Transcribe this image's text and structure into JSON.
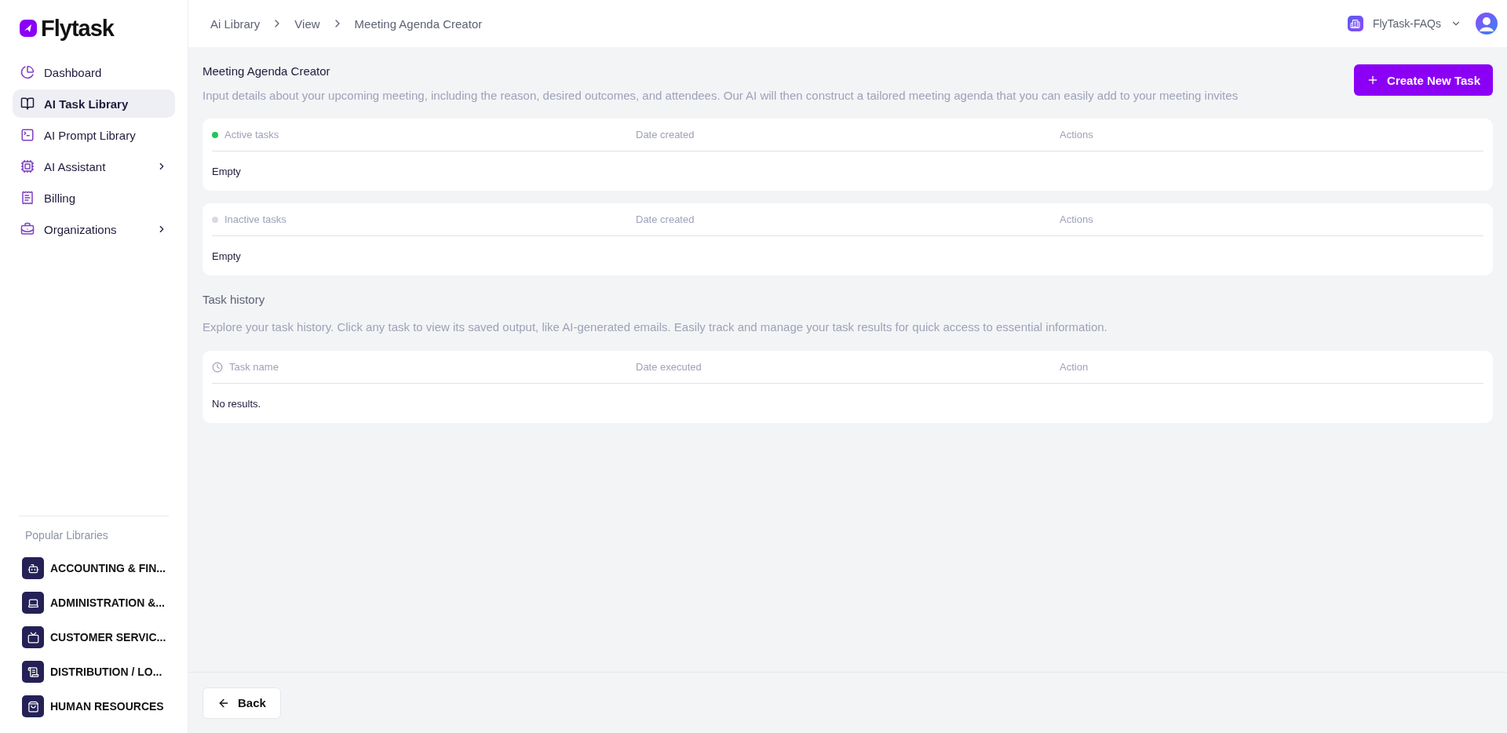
{
  "logo": "Flytask",
  "sidebar": {
    "items": [
      {
        "label": "Dashboard",
        "selected": false,
        "expandable": false
      },
      {
        "label": "AI Task Library",
        "selected": true,
        "expandable": false
      },
      {
        "label": "AI Prompt Library",
        "selected": false,
        "expandable": false
      },
      {
        "label": "AI Assistant",
        "selected": false,
        "expandable": true
      },
      {
        "label": "Billing",
        "selected": false,
        "expandable": false
      },
      {
        "label": "Organizations",
        "selected": false,
        "expandable": true
      }
    ],
    "popular_title": "Popular Libraries",
    "libraries": [
      "ACCOUNTING & FIN...",
      "ADMINISTRATION &...",
      "CUSTOMER SERVIC...",
      "DISTRIBUTION / LO...",
      "HUMAN RESOURCES"
    ]
  },
  "breadcrumbs": [
    "Ai Library",
    "View",
    "Meeting Agenda Creator"
  ],
  "workspace": "FlyTask-FAQs",
  "page": {
    "title": "Meeting Agenda Creator",
    "description": "Input details about your upcoming meeting, including the reason, desired outcomes, and attendees. Our AI will then construct a tailored meeting agenda that you can easily add to your meeting invites",
    "create_button": "Create New Task"
  },
  "task_tables": [
    {
      "kind": "status",
      "color": "#22c55e",
      "columns": [
        "Active tasks",
        "Date created",
        "Actions"
      ],
      "empty": "Empty"
    },
    {
      "kind": "status",
      "color": "#d9dbe3",
      "columns": [
        "Inactive tasks",
        "Date created",
        "Actions"
      ],
      "empty": "Empty"
    }
  ],
  "history": {
    "title": "Task history",
    "description": "Explore your task history. Click any task to view its saved output, like AI-generated emails. Easily track and manage your task results for quick access to essential information.",
    "table": {
      "kind": "history",
      "columns": [
        "Task name",
        "Date executed",
        "Action"
      ],
      "empty": "No results."
    }
  },
  "back_button": "Back"
}
